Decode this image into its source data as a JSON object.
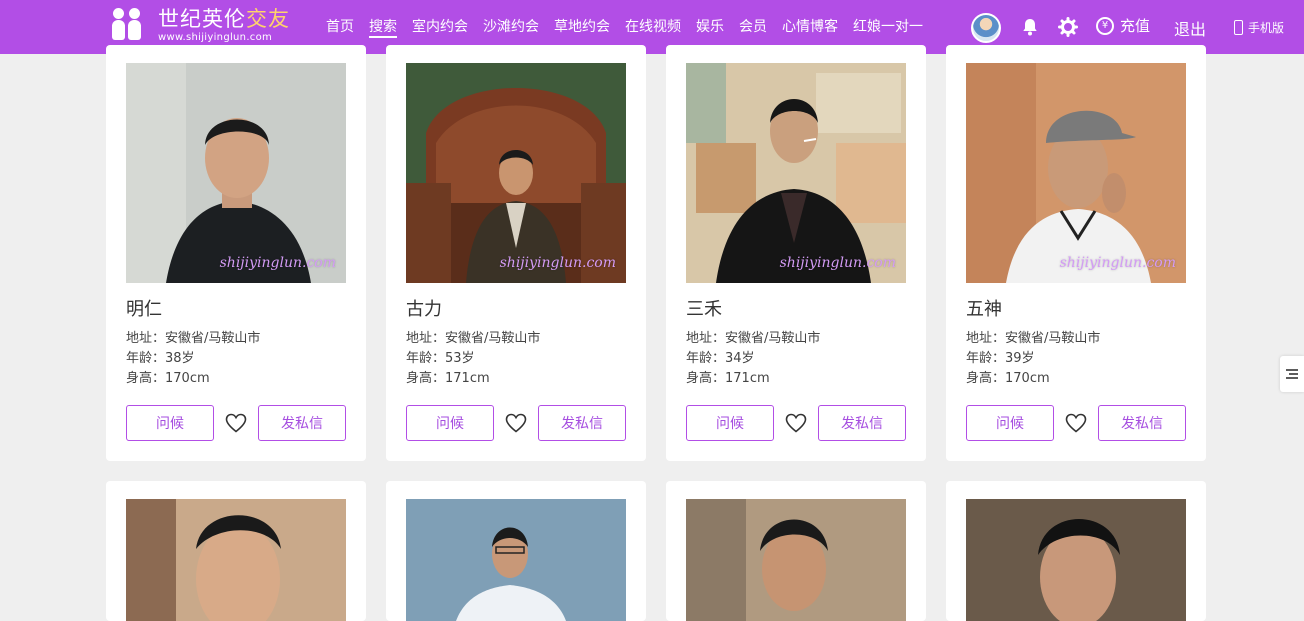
{
  "header": {
    "logo_title_a": "世纪英伦",
    "logo_title_b": "交友",
    "logo_url": "www.shijiyinglun.com",
    "nav": [
      "首页",
      "搜索",
      "室内约会",
      "沙滩约会",
      "草地约会",
      "在线视频",
      "娱乐",
      "会员",
      "心情博客",
      "红娘一对一"
    ],
    "active_nav": "搜索",
    "recharge_label": "充值",
    "recharge_icon": "¥",
    "logout_label": "退出",
    "mobile_label": "手机版"
  },
  "labels": {
    "greet": "问候",
    "message": "发私信",
    "watermark": "shijiyinglun.com"
  },
  "profiles": [
    {
      "name": "明仁",
      "address": "地址：安徽省/马鞍山市",
      "age": "年龄：38岁",
      "height": "身高：170cm"
    },
    {
      "name": "古力",
      "address": "地址：安徽省/马鞍山市",
      "age": "年龄：53岁",
      "height": "身高：171cm"
    },
    {
      "name": "三禾",
      "address": "地址：安徽省/马鞍山市",
      "age": "年龄：34岁",
      "height": "身高：171cm"
    },
    {
      "name": "五神",
      "address": "地址：安徽省/马鞍山市",
      "age": "年龄：39岁",
      "height": "身高：170cm"
    }
  ],
  "colors": {
    "brand": "#b24ee6",
    "accent": "#ffd36b",
    "button_text": "#a64ee0"
  }
}
